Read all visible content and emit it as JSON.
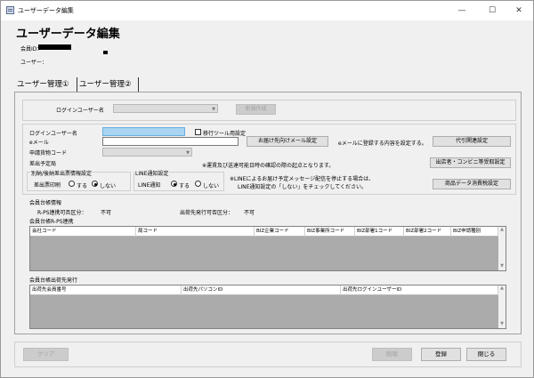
{
  "window": {
    "title": "ユーザーデータ編集",
    "minimize": "—",
    "maximize": "☐",
    "close": "✕"
  },
  "header": {
    "page_title": "ユーザーデータ編集",
    "member_id_label": "会員ID：",
    "user_label": "ユーザー："
  },
  "tabs": [
    {
      "label": "ユーザー管理①"
    },
    {
      "label": "ユーザー管理②"
    }
  ],
  "login_user": {
    "label": "ログインユーザー名",
    "new_button": "新規作成"
  },
  "form": {
    "login_user_name_label": "ログインユーザー名",
    "transfer_tool_label": "移行ツール用設定",
    "email_label": "eメール",
    "delivery_mail_button": "お届け先向けメール設定",
    "email_note": "eメールに登録する内容を設定する。",
    "proxy_button": "代引関連設定",
    "application_code_label": "申請貨物コード",
    "departure_label": "差出予定局",
    "departure_note": "※運賃及び送達可能日時の確認の際の起点となります。",
    "store_button": "出店者・コンビニ等受取設定",
    "separate_label": "別納/後納差出票情報設定",
    "print_label": "差出票印刷",
    "print_yes": "する",
    "print_no": "しない",
    "line_group_label": "LINE通知設定",
    "line_label": "LINE通知",
    "line_yes": "する",
    "line_no": "しない",
    "line_note_1": "※LINEによるお届け予定メッセージ配信を停止する場合は、",
    "line_note_2": "LINE通知設定の「しない」をチェックしてください。",
    "tax_button": "商品データ消費税設定"
  },
  "member_info": {
    "title": "会員台帳情報",
    "rps_label": "R-PS連携可否区分：",
    "rps_value": "不可",
    "dest_label": "出荷先発行可否区分：",
    "dest_value": "不可",
    "rps_section": "会員台帳R-PS連携",
    "rps_columns": [
      "会社コード",
      "局コード",
      "BIZ企業コード",
      "BIZ事業所コード",
      "BIZ部署1コード",
      "BIZ部署2コード",
      "BIZ申請種別"
    ],
    "dest_section": "会員台帳出荷先発行",
    "dest_columns": [
      "出荷先会員番号",
      "出荷先パソコンID",
      "出荷先ログインユーザーID"
    ]
  },
  "footer": {
    "clear_button": "クリア",
    "delete_button": "削除",
    "register_button": "登録",
    "close_button": "閉じる"
  },
  "colors": {
    "highlight_input": "#a9d5f2",
    "window_bg": "#f0f0f0"
  }
}
